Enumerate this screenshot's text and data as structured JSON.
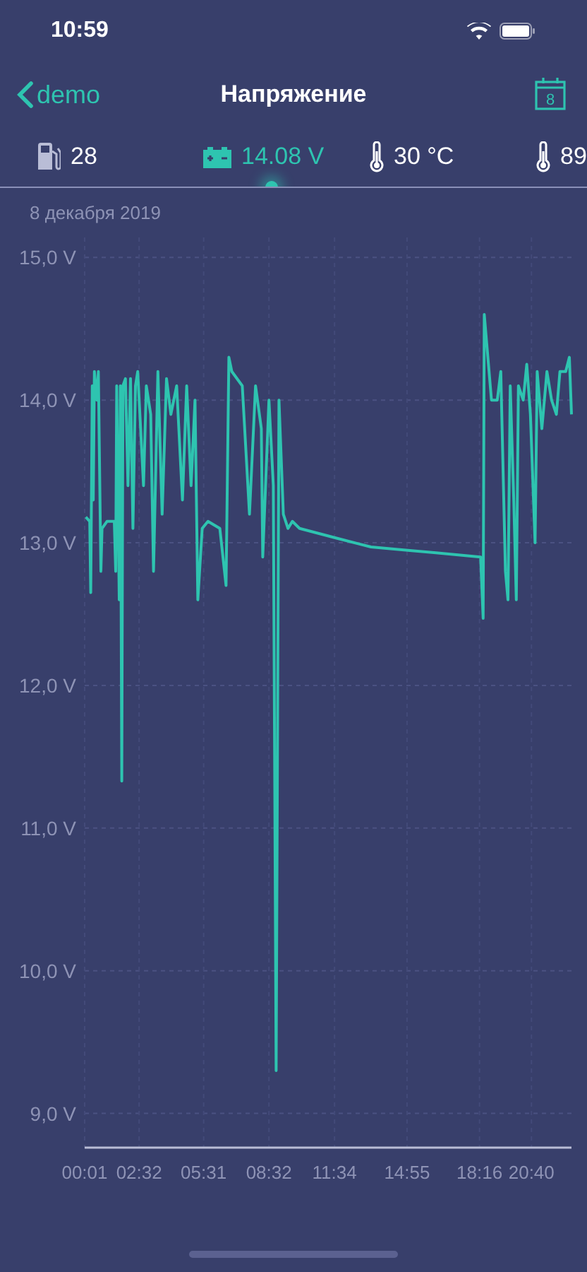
{
  "status_bar": {
    "time": "10:59"
  },
  "nav": {
    "back_label": "demo",
    "title": "Напряжение",
    "calendar_day": "8"
  },
  "tabs": [
    {
      "kind": "fuel",
      "label": "28",
      "selected": false
    },
    {
      "kind": "battery",
      "label": "14.08 V",
      "selected": true
    },
    {
      "kind": "thermometer",
      "label": "30 °C",
      "selected": false
    },
    {
      "kind": "thermometer",
      "label": "89",
      "selected": false
    }
  ],
  "date": "8 декабря 2019",
  "chart": {
    "chart_data": {
      "type": "line",
      "grid": true,
      "xlim": [
        1,
        1351
      ],
      "ylim": [
        8.76,
        15.14
      ],
      "xticks": [
        {
          "value": 1,
          "label": "00:01"
        },
        {
          "value": 152,
          "label": "02:32"
        },
        {
          "value": 331,
          "label": "05:31"
        },
        {
          "value": 512,
          "label": "08:32"
        },
        {
          "value": 694,
          "label": "11:34"
        },
        {
          "value": 895,
          "label": "14:55"
        },
        {
          "value": 1096,
          "label": "18:16"
        },
        {
          "value": 1240,
          "label": "20:40"
        }
      ],
      "yticks": [
        {
          "value": 9,
          "label": "9,0 V"
        },
        {
          "value": 10,
          "label": "10,0 V"
        },
        {
          "value": 11,
          "label": "11,0 V"
        },
        {
          "value": 12,
          "label": "12,0 V"
        },
        {
          "value": 13,
          "label": "13,0 V"
        },
        {
          "value": 14,
          "label": "14,0 V"
        },
        {
          "value": 15,
          "label": "15,0 V"
        }
      ],
      "x": [
        4,
        15,
        18,
        22,
        25,
        28,
        35,
        39,
        46,
        49,
        63,
        83,
        87,
        90,
        97,
        100,
        104,
        107,
        114,
        121,
        128,
        135,
        142,
        148,
        164,
        172,
        184,
        192,
        204,
        216,
        228,
        240,
        256,
        272,
        284,
        296,
        307,
        315,
        327,
        343,
        376,
        393,
        401,
        409,
        438,
        458,
        475,
        491,
        495,
        512,
        524,
        532,
        540,
        552,
        565,
        577,
        597,
        703,
        795,
        886,
        975,
        1099,
        1106,
        1109,
        1116,
        1129,
        1145,
        1155,
        1168,
        1175,
        1181,
        1191,
        1198,
        1204,
        1217,
        1227,
        1237,
        1250,
        1256,
        1269,
        1283,
        1296,
        1309,
        1319,
        1335,
        1345,
        1351
      ],
      "series": [
        {
          "color": "#2ec4b0",
          "values": [
            13.18,
            13.15,
            12.65,
            14.1,
            13.3,
            14.2,
            14.0,
            14.2,
            12.8,
            13.1,
            13.15,
            13.15,
            12.8,
            14.1,
            12.6,
            14.1,
            11.33,
            14.1,
            14.15,
            13.4,
            14.15,
            13.1,
            14.1,
            14.2,
            13.4,
            14.1,
            13.9,
            12.8,
            14.2,
            13.2,
            14.15,
            13.9,
            14.1,
            13.3,
            14.1,
            13.4,
            14.0,
            12.6,
            13.1,
            13.15,
            13.1,
            12.7,
            14.3,
            14.2,
            14.1,
            13.2,
            14.1,
            13.8,
            12.9,
            14.0,
            13.4,
            9.3,
            14.0,
            13.2,
            13.1,
            13.15,
            13.1,
            13.03,
            12.97,
            12.95,
            12.93,
            12.9,
            12.47,
            14.6,
            14.4,
            14.0,
            14.0,
            14.2,
            12.8,
            12.6,
            14.1,
            13.3,
            12.6,
            14.1,
            14.0,
            14.25,
            13.9,
            13.0,
            14.2,
            13.8,
            14.2,
            14.0,
            13.9,
            14.2,
            14.2,
            14.3,
            13.9
          ]
        }
      ]
    }
  }
}
